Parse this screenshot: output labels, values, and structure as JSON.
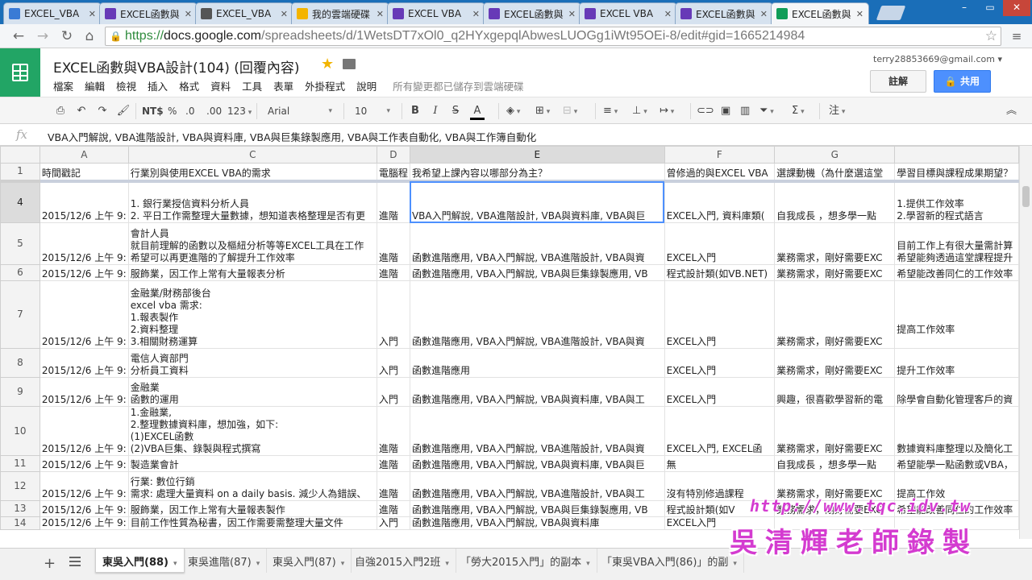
{
  "browser": {
    "tabs": [
      {
        "label": "EXCEL_VBA",
        "icon": "drive-icon",
        "color": "#3a7bd5"
      },
      {
        "label": "EXCEL函數與",
        "icon": "forms-icon",
        "color": "#673ab7"
      },
      {
        "label": "EXCEL_VBA",
        "icon": "youtube-icon",
        "color": "#555555"
      },
      {
        "label": "我的雲端硬碟",
        "icon": "drive-icon",
        "color": "#f4b400"
      },
      {
        "label": "EXCEL VBA",
        "icon": "forms-icon",
        "color": "#673ab7"
      },
      {
        "label": "EXCEL函數與",
        "icon": "forms-icon",
        "color": "#673ab7"
      },
      {
        "label": "EXCEL VBA",
        "icon": "forms-icon",
        "color": "#673ab7"
      },
      {
        "label": "EXCEL函數與",
        "icon": "forms-icon",
        "color": "#673ab7"
      },
      {
        "label": "EXCEL函數與",
        "icon": "sheets-icon",
        "color": "#0f9d58",
        "active": true
      }
    ],
    "url_scheme": "https://",
    "url_host": "docs.google.com",
    "url_path": "/spreadsheets/d/1WetsDT7xOl0_q2HYxgepqlAbwesLUOGg1iWt95OEi-8/edit#gid=1665214984"
  },
  "doc": {
    "title": "EXCEL函數與VBA設計(104) (回覆內容)",
    "menu": [
      "檔案",
      "編輯",
      "檢視",
      "插入",
      "格式",
      "資料",
      "工具",
      "表單",
      "外掛程式",
      "說明"
    ],
    "saved_status": "所有變更都已儲存到雲端硬碟",
    "account": "terry28853669@gmail.com",
    "comments_label": "註解",
    "share_label": "共用"
  },
  "toolbar": {
    "currency": "NT$",
    "percent": "%",
    "dec_less": ".0",
    "dec_more": ".00",
    "number_format": "123",
    "font": "Arial",
    "font_size": "10",
    "bold": "B",
    "italic": "I",
    "strike": "S",
    "text_color": "A",
    "sigma": "Σ",
    "comment": "注"
  },
  "formula": "VBA入門解說, VBA進階設計, VBA與資料庫, VBA與巨集錄製應用, VBA與工作表自動化, VBA與工作簿自動化",
  "grid": {
    "columns": [
      "A",
      "C",
      "D",
      "E",
      "F",
      "G",
      ""
    ],
    "header_row": {
      "num": "1",
      "cells": [
        "時間戳記",
        "行業別與使用EXCEL VBA的需求",
        "電腦程",
        "我希望上課內容以哪部分為主？",
        "曾修過的與EXCEL VBA",
        "選課動機（為什麼選這堂",
        "學習目標與課程成果期望？"
      ]
    },
    "rows": [
      {
        "num": "4",
        "cells": [
          "2015/12/6 上午 9:",
          "1. 銀行業授信資料分析人員\n2. 平日工作需整理大量數據，想知道表格整理是否有更",
          "進階",
          "VBA入門解說, VBA進階設計, VBA與資料庫, VBA與巨",
          "EXCEL入門, 資料庫類(",
          "自我成長 ，想多學一點",
          "1.提供工作效率\n2.學習新的程式語言"
        ]
      },
      {
        "num": "5",
        "cells": [
          "2015/12/6 上午 9:",
          "會計人員\n就目前理解的函數以及樞紐分析等等EXCEL工具在工作\n希望可以再更進階的了解提升工作效率",
          "進階",
          "函數進階應用, VBA入門解說, VBA進階設計, VBA與資",
          "EXCEL入門",
          "業務需求，剛好需要EXC",
          "目前工作上有很大量需計算\n希望能夠透過這堂課程提升"
        ]
      },
      {
        "num": "6",
        "cells": [
          "2015/12/6 上午 9:",
          "服飾業，因工作上常有大量報表分析",
          "進階",
          "函數進階應用, VBA入門解說, VBA與巨集錄製應用, VB",
          "程式設計類(如VB.NET)",
          "業務需求，剛好需要EXC",
          "希望能改善同仁的工作效率"
        ]
      },
      {
        "num": "7",
        "cells": [
          "2015/12/6 上午 9:",
          "金融業/財務部後台\nexcel vba 需求:\n1.報表製作\n2.資料整理\n3.相關財務運算",
          "入門",
          "函數進階應用, VBA入門解說, VBA進階設計, VBA與資",
          "EXCEL入門",
          "業務需求，剛好需要EXC",
          "提高工作效率\n "
        ]
      },
      {
        "num": "8",
        "cells": [
          "2015/12/6 上午 9:",
          "電信人資部門\n分析員工資料",
          "入門",
          "函數進階應用",
          "EXCEL入門",
          "業務需求，剛好需要EXC",
          "提升工作效率"
        ]
      },
      {
        "num": "9",
        "cells": [
          "2015/12/6 上午 9:",
          "金融業\n函數的運用",
          "入門",
          "函數進階應用, VBA入門解說, VBA與資料庫, VBA與工",
          "EXCEL入門",
          "興趣，很喜歡學習新的電",
          "除學會自動化管理客戶的資"
        ]
      },
      {
        "num": "10",
        "cells": [
          "2015/12/6 上午 9:",
          "1.金融業,\n2.整理數據資料庫，想加強，如下:\n(1)EXCEL函數\n(2)VBA巨集、錄製與程式撰寫",
          "進階",
          "函數進階應用, VBA入門解說, VBA進階設計, VBA與資",
          "EXCEL入門, EXCEL函",
          "業務需求，剛好需要EXC",
          "數據資料庫整理以及簡化工"
        ]
      },
      {
        "num": "11",
        "cells": [
          "2015/12/6 上午 9:",
          "製造業會計",
          "進階",
          "函數進階應用, VBA入門解說, VBA與資料庫, VBA與巨",
          "無",
          "自我成長 ，想多學一點",
          "希望能學一點函數或VBA，"
        ]
      },
      {
        "num": "12",
        "cells": [
          "2015/12/6 上午 9:",
          "行業: 數位行銷\n需求: 處理大量資料 on a daily basis. 減少人為錯誤、",
          "進階",
          "函數進階應用, VBA入門解說, VBA進階設計, VBA與工",
          "沒有特別修過課程",
          "業務需求，剛好需要EXC",
          "提高工作效"
        ]
      },
      {
        "num": "13",
        "cells": [
          "2015/12/6 上午 9:",
          "服飾業，因工作上常有大量報表製作",
          "進階",
          "函數進階應用, VBA入門解說, VBA與巨集錄製應用, VB",
          "程式設計類(如V",
          "業務需求，剛好需要EXC",
          "希望能改善同仁的工作效率"
        ]
      },
      {
        "num": "14",
        "cells": [
          "2015/12/6 上午 9:",
          "目前工作性質為秘書，因工作需要需整理大量文件",
          "入門",
          "函數進階應用, VBA入門解說, VBA與資料庫",
          "EXCEL入門",
          "",
          ""
        ]
      }
    ]
  },
  "sheet_tabs": [
    "東吳入門(88)",
    "東吳進階(87)",
    "東吳入門(87)",
    "自強2015入門2班",
    "「勞大2015入門」的副本",
    "「東吳VBA入門(86)」的副"
  ],
  "watermark": {
    "url": "http://www.tqc.idv.tw",
    "name": "吳清輝老師錄製"
  }
}
